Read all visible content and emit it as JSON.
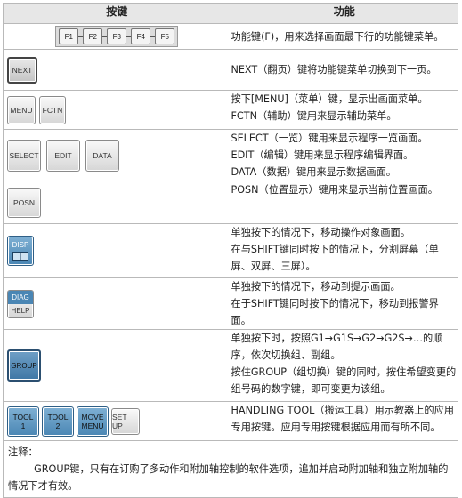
{
  "header": {
    "key_col": "按键",
    "func_col": "功能"
  },
  "rows": [
    {
      "keys": [
        "F1",
        "F2",
        "F3",
        "F4",
        "F5"
      ],
      "desc": [
        "功能键(F)，用来选择画面最下行的功能键菜单。"
      ]
    },
    {
      "keys": [
        "NEXT"
      ],
      "desc": [
        "NEXT（翻页）键将功能键菜单切换到下一页。"
      ]
    },
    {
      "keys": [
        "MENU",
        "FCTN"
      ],
      "desc": [
        "按下[MENU]（菜单）键，显示出画面菜单。",
        "FCTN（辅助）键用来显示辅助菜单。"
      ]
    },
    {
      "keys": [
        "SELECT",
        "EDIT",
        "DATA"
      ],
      "desc": [
        "SELECT（一览）键用来显示程序一览画面。",
        "EDIT（编辑）键用来显示程序编辑界面。",
        "DATA（数据）键用来显示数据画面。"
      ]
    },
    {
      "keys": [
        "POSN"
      ],
      "desc": [
        "POSN（位置显示）键用来显示当前位置画面。"
      ]
    },
    {
      "keys": [
        "DISP"
      ],
      "desc": [
        "单独按下的情况下，移动操作对象画面。",
        "在与SHIFT键同时按下的情况下，分割屏幕（单屏、双屏、三屏）。"
      ]
    },
    {
      "keys": [
        "DIAG",
        "HELP"
      ],
      "desc": [
        "单独按下的情况下，移动到提示画面。",
        "在于SHIFT键同时按下的情况下，移动到报警界面。"
      ]
    },
    {
      "keys": [
        "GROUP"
      ],
      "desc": [
        "单独按下时，按照G1→G1S→G2→G2S→…的顺序，依次切换组、副组。",
        "按住GROUP（组切换）键的同时，按住希望变更的组号码的数字键，即可变更为该组。"
      ]
    },
    {
      "keys": [
        "TOOL 1",
        "TOOL 2",
        "MOVE MENU",
        "SET UP"
      ],
      "tool_lines": [
        [
          "TOOL",
          "1"
        ],
        [
          "TOOL",
          "2"
        ],
        [
          "MOVE",
          "MENU"
        ],
        [
          "SET UP"
        ]
      ],
      "desc": [
        "HANDLING TOOL（搬运工具）用示教器上的应用专用按键。应用专用按键根据应用而有所不同。"
      ]
    }
  ],
  "note": {
    "title": "注释：",
    "text": "GROUP键，只有在订购了多动作和附加轴控制的软件选项，追加并启动附加轴和独立附加轴的情况下才有效。"
  }
}
